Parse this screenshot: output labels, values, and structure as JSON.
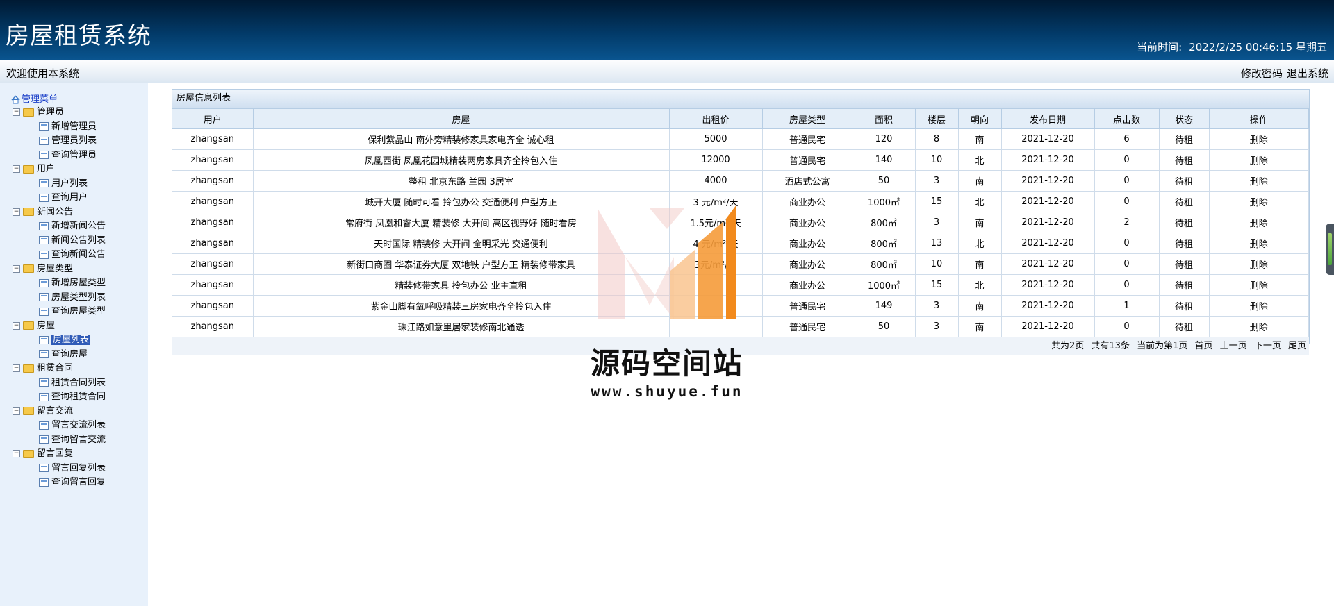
{
  "header": {
    "title": "房屋租赁系统",
    "time_label": "当前时间:",
    "time_value": "2022/2/25 00:46:15 星期五"
  },
  "bar": {
    "welcome": "欢迎使用本系统",
    "change_password": "修改密码",
    "logout": "退出系统"
  },
  "sidebar": {
    "root": "管理菜单",
    "groups": [
      {
        "label": "管理员",
        "items": [
          "新增管理员",
          "管理员列表",
          "查询管理员"
        ]
      },
      {
        "label": "用户",
        "items": [
          "用户列表",
          "查询用户"
        ]
      },
      {
        "label": "新闻公告",
        "items": [
          "新增新闻公告",
          "新闻公告列表",
          "查询新闻公告"
        ]
      },
      {
        "label": "房屋类型",
        "items": [
          "新增房屋类型",
          "房屋类型列表",
          "查询房屋类型"
        ]
      },
      {
        "label": "房屋",
        "items": [
          "房屋列表",
          "查询房屋"
        ]
      },
      {
        "label": "租赁合同",
        "items": [
          "租赁合同列表",
          "查询租赁合同"
        ]
      },
      {
        "label": "留言交流",
        "items": [
          "留言交流列表",
          "查询留言交流"
        ]
      },
      {
        "label": "留言回复",
        "items": [
          "留言回复列表",
          "查询留言回复"
        ]
      }
    ],
    "selected": "房屋列表"
  },
  "panel": {
    "title": "房屋信息列表",
    "columns": [
      "用户",
      "房屋",
      "出租价",
      "房屋类型",
      "面积",
      "楼层",
      "朝向",
      "发布日期",
      "点击数",
      "状态",
      "操作"
    ],
    "rows": [
      [
        "zhangsan",
        "保利紫晶山 南外旁精装修家具家电齐全 诚心租",
        "5000",
        "普通民宅",
        "120",
        "8",
        "南",
        "2021-12-20",
        "6",
        "待租",
        "删除"
      ],
      [
        "zhangsan",
        "凤凰西街 凤凰花园城精装两房家具齐全拎包入住",
        "12000",
        "普通民宅",
        "140",
        "10",
        "北",
        "2021-12-20",
        "0",
        "待租",
        "删除"
      ],
      [
        "zhangsan",
        "整租 北京东路 兰园 3居室",
        "4000",
        "酒店式公寓",
        "50",
        "3",
        "南",
        "2021-12-20",
        "0",
        "待租",
        "删除"
      ],
      [
        "zhangsan",
        "城开大厦 随时可看 拎包办公 交通便利 户型方正",
        "3 元/m²/天",
        "商业办公",
        "1000㎡",
        "15",
        "北",
        "2021-12-20",
        "0",
        "待租",
        "删除"
      ],
      [
        "zhangsan",
        "常府街 凤凰和睿大厦 精装修 大开间 高区视野好 随时看房",
        "1.5元/m²/天",
        "商业办公",
        "800㎡",
        "3",
        "南",
        "2021-12-20",
        "2",
        "待租",
        "删除"
      ],
      [
        "zhangsan",
        "天时国际 精装修 大开间 全明采光 交通便利",
        "4 元/m²/天",
        "商业办公",
        "800㎡",
        "13",
        "北",
        "2021-12-20",
        "0",
        "待租",
        "删除"
      ],
      [
        "zhangsan",
        "新街口商圈 华泰证券大厦 双地铁 户型方正 精装修带家具",
        "3元/m²/天",
        "商业办公",
        "800㎡",
        "10",
        "南",
        "2021-12-20",
        "0",
        "待租",
        "删除"
      ],
      [
        "zhangsan",
        "精装修带家具 拎包办公 业主直租",
        "",
        "商业办公",
        "1000㎡",
        "15",
        "北",
        "2021-12-20",
        "0",
        "待租",
        "删除"
      ],
      [
        "zhangsan",
        "紫金山脚有氧呼吸精装三房家电齐全拎包入住",
        "",
        "普通民宅",
        "149",
        "3",
        "南",
        "2021-12-20",
        "1",
        "待租",
        "删除"
      ],
      [
        "zhangsan",
        "珠江路如意里居家装修南北通透",
        "",
        "普通民宅",
        "50",
        "3",
        "南",
        "2021-12-20",
        "0",
        "待租",
        "删除"
      ]
    ],
    "pager": {
      "total_pages": "共为2页",
      "total_items": "共有13条",
      "current": "当前为第1页",
      "first": "首页",
      "prev": "上一页",
      "next": "下一页",
      "last": "尾页"
    }
  },
  "watermark": {
    "text": "源码空间站",
    "url": "www.shuyue.fun"
  }
}
